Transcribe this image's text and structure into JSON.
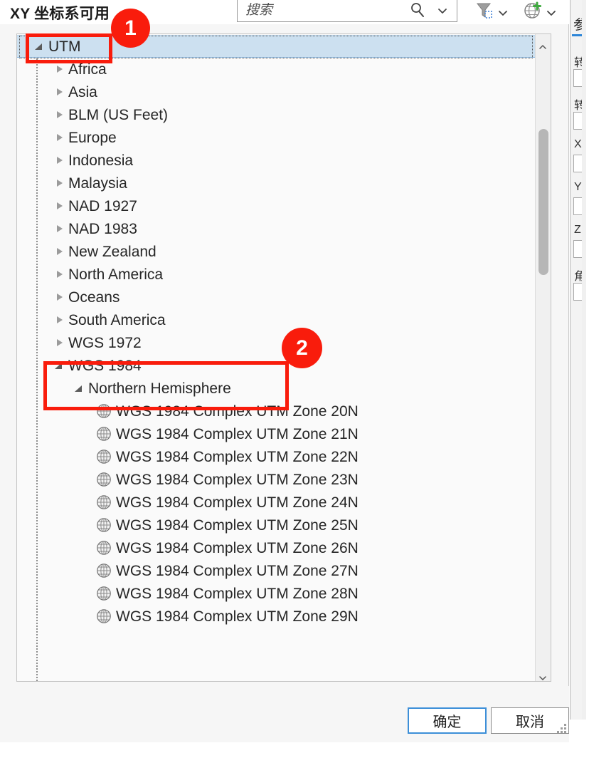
{
  "dialog": {
    "title": "XY 坐标系可用"
  },
  "search": {
    "placeholder": "搜索",
    "value": "",
    "icon": "search-icon",
    "dropdown_icon": "chevron-down-icon"
  },
  "toolbar": {
    "buttons": [
      {
        "name": "filter-button",
        "icon": "filter-icon",
        "dropdown_icon": "chevron-down-icon"
      },
      {
        "name": "add-coordinate-system-button",
        "icon": "globe-add-icon",
        "dropdown_icon": "chevron-down-icon"
      }
    ]
  },
  "side_panel": {
    "tab_label": "参数",
    "fields": [
      {
        "label": "转"
      },
      {
        "label": "转"
      },
      {
        "label": "X"
      },
      {
        "label": "Y"
      },
      {
        "label": "Z"
      },
      {
        "label": "角"
      }
    ]
  },
  "tree": {
    "rows": [
      {
        "label": "UTM",
        "indent": 0,
        "state": "expanded",
        "icon": "none",
        "selected": true
      },
      {
        "label": "Africa",
        "indent": 1,
        "state": "collapsed",
        "icon": "none",
        "selected": false
      },
      {
        "label": "Asia",
        "indent": 1,
        "state": "collapsed",
        "icon": "none",
        "selected": false
      },
      {
        "label": "BLM (US Feet)",
        "indent": 1,
        "state": "collapsed",
        "icon": "none",
        "selected": false
      },
      {
        "label": "Europe",
        "indent": 1,
        "state": "collapsed",
        "icon": "none",
        "selected": false
      },
      {
        "label": "Indonesia",
        "indent": 1,
        "state": "collapsed",
        "icon": "none",
        "selected": false
      },
      {
        "label": "Malaysia",
        "indent": 1,
        "state": "collapsed",
        "icon": "none",
        "selected": false
      },
      {
        "label": "NAD 1927",
        "indent": 1,
        "state": "collapsed",
        "icon": "none",
        "selected": false
      },
      {
        "label": "NAD 1983",
        "indent": 1,
        "state": "collapsed",
        "icon": "none",
        "selected": false
      },
      {
        "label": "New Zealand",
        "indent": 1,
        "state": "collapsed",
        "icon": "none",
        "selected": false
      },
      {
        "label": "North America",
        "indent": 1,
        "state": "collapsed",
        "icon": "none",
        "selected": false
      },
      {
        "label": "Oceans",
        "indent": 1,
        "state": "collapsed",
        "icon": "none",
        "selected": false
      },
      {
        "label": "South America",
        "indent": 1,
        "state": "collapsed",
        "icon": "none",
        "selected": false
      },
      {
        "label": "WGS 1972",
        "indent": 1,
        "state": "collapsed",
        "icon": "none",
        "selected": false
      },
      {
        "label": "WGS 1984",
        "indent": 1,
        "state": "expanded",
        "icon": "none",
        "selected": false
      },
      {
        "label": "Northern Hemisphere",
        "indent": 2,
        "state": "expanded",
        "icon": "none",
        "selected": false
      },
      {
        "label": "WGS 1984 Complex UTM Zone 20N",
        "indent": 3,
        "state": "leaf",
        "icon": "globe-icon",
        "selected": false
      },
      {
        "label": "WGS 1984 Complex UTM Zone 21N",
        "indent": 3,
        "state": "leaf",
        "icon": "globe-icon",
        "selected": false
      },
      {
        "label": "WGS 1984 Complex UTM Zone 22N",
        "indent": 3,
        "state": "leaf",
        "icon": "globe-icon",
        "selected": false
      },
      {
        "label": "WGS 1984 Complex UTM Zone 23N",
        "indent": 3,
        "state": "leaf",
        "icon": "globe-icon",
        "selected": false
      },
      {
        "label": "WGS 1984 Complex UTM Zone 24N",
        "indent": 3,
        "state": "leaf",
        "icon": "globe-icon",
        "selected": false
      },
      {
        "label": "WGS 1984 Complex UTM Zone 25N",
        "indent": 3,
        "state": "leaf",
        "icon": "globe-icon",
        "selected": false
      },
      {
        "label": "WGS 1984 Complex UTM Zone 26N",
        "indent": 3,
        "state": "leaf",
        "icon": "globe-icon",
        "selected": false
      },
      {
        "label": "WGS 1984 Complex UTM Zone 27N",
        "indent": 3,
        "state": "leaf",
        "icon": "globe-icon",
        "selected": false
      },
      {
        "label": "WGS 1984 Complex UTM Zone 28N",
        "indent": 3,
        "state": "leaf",
        "icon": "globe-icon",
        "selected": false
      },
      {
        "label": "WGS 1984 Complex UTM Zone 29N",
        "indent": 3,
        "state": "leaf",
        "icon": "globe-icon",
        "selected": false
      }
    ]
  },
  "scrollbar": {
    "up_icon": "chevron-up-icon",
    "down_icon": "chevron-down-icon"
  },
  "footer": {
    "ok_label": "确定",
    "cancel_label": "取消"
  },
  "annotations": {
    "colors": {
      "highlight": "#f91c0c"
    },
    "badges": [
      {
        "label": "1"
      },
      {
        "label": "2"
      }
    ]
  }
}
